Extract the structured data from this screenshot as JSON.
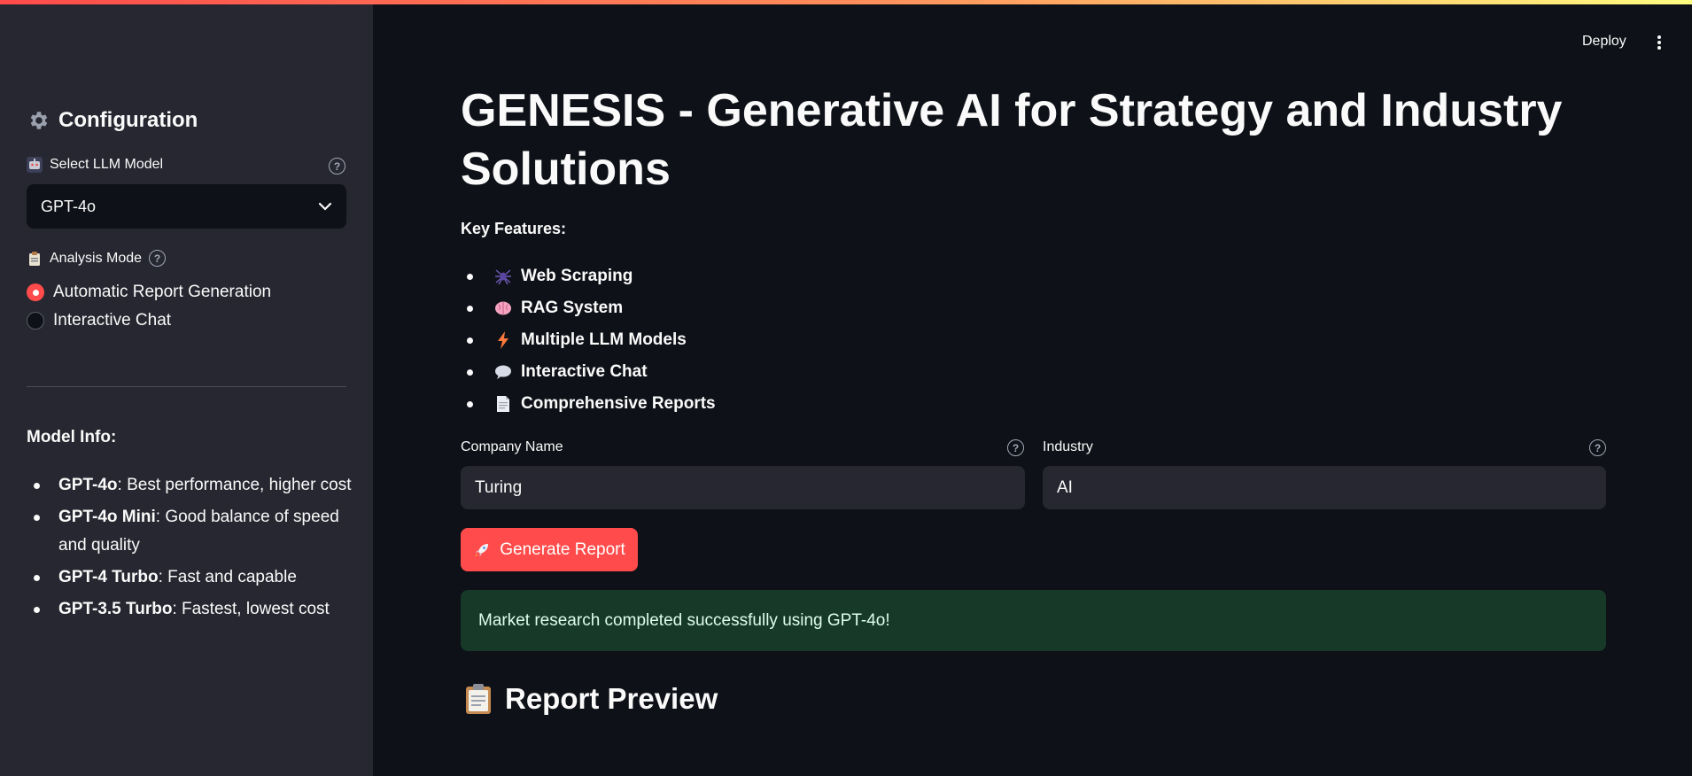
{
  "sidebar": {
    "title": "Configuration",
    "model_select": {
      "label": "Select LLM Model",
      "value": "GPT-4o"
    },
    "analysis_mode": {
      "label": "Analysis Mode",
      "options": [
        "Automatic Report Generation",
        "Interactive Chat"
      ],
      "selected": "Automatic Report Generation"
    },
    "model_info": {
      "title": "Model Info:",
      "items": [
        {
          "name": "GPT-4o",
          "desc": ": Best performance, higher cost"
        },
        {
          "name": "GPT-4o Mini",
          "desc": ": Good balance of speed and quality"
        },
        {
          "name": "GPT-4 Turbo",
          "desc": ": Fast and capable"
        },
        {
          "name": "GPT-3.5 Turbo",
          "desc": ": Fastest, lowest cost"
        }
      ]
    }
  },
  "header": {
    "deploy_label": "Deploy"
  },
  "main": {
    "title": "GENESIS - Generative AI for Strategy and Industry Solutions",
    "key_features_label": "Key Features:",
    "features": [
      {
        "icon": "spider-icon",
        "label": "Web Scraping"
      },
      {
        "icon": "brain-icon",
        "label": "RAG System"
      },
      {
        "icon": "lightning-icon",
        "label": "Multiple LLM Models"
      },
      {
        "icon": "speech-bubble-icon",
        "label": "Interactive Chat"
      },
      {
        "icon": "document-icon",
        "label": "Comprehensive Reports"
      }
    ],
    "company_field": {
      "label": "Company Name",
      "value": "Turing"
    },
    "industry_field": {
      "label": "Industry",
      "value": "AI"
    },
    "generate_button": "Generate Report",
    "success_message": "Market research completed successfully using GPT-4o!",
    "report_preview_title": "Report Preview"
  },
  "colors": {
    "accent": "#ff4b4b",
    "sidebar_bg": "#262730",
    "main_bg": "#0e1117",
    "success_bg": "#173928"
  }
}
